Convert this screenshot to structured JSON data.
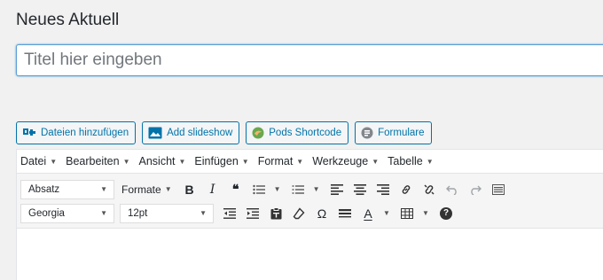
{
  "page": {
    "title": "Neues Aktuell"
  },
  "title_field": {
    "placeholder": "Titel hier eingeben",
    "value": ""
  },
  "media_buttons": [
    {
      "label": "Dateien hinzufügen",
      "icon": "media-add-icon"
    },
    {
      "label": "Add slideshow",
      "icon": "slideshow-icon"
    },
    {
      "label": "Pods Shortcode",
      "icon": "pods-icon"
    },
    {
      "label": "Formulare",
      "icon": "forms-icon"
    }
  ],
  "menubar": {
    "items": [
      "Datei",
      "Bearbeiten",
      "Ansicht",
      "Einfügen",
      "Format",
      "Werkzeuge",
      "Tabelle"
    ]
  },
  "toolbar1": {
    "block_format": "Absatz",
    "formats_label": "Formate",
    "bold": "B",
    "italic": "I",
    "blockquote": "❝",
    "special_char": "Ω",
    "text_color": "A",
    "help": "?"
  },
  "toolbar2": {
    "font_family": "Georgia",
    "font_size": "12pt"
  },
  "colors": {
    "accent": "#0073aa",
    "focus_border": "#5b9dd9",
    "background": "#f1f1f1",
    "pods_green": "#6aa84f"
  }
}
